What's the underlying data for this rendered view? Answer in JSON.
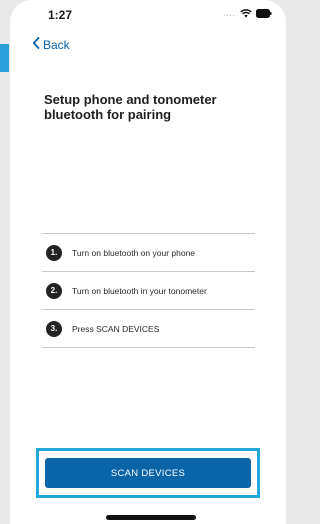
{
  "status_bar": {
    "time": "1:27",
    "signal": "....",
    "wifi_icon": "wifi-icon",
    "battery_icon": "battery-icon"
  },
  "nav": {
    "back_label": "Back",
    "back_icon": "chevron-left-icon"
  },
  "page": {
    "title": "Setup phone and tonometer bluetooth for pairing"
  },
  "steps": [
    {
      "number": "1.",
      "text": "Turn on bluetooth on your phone"
    },
    {
      "number": "2.",
      "text": "Turn on bluetooth in your tonometer"
    },
    {
      "number": "3.",
      "text": "Press SCAN DEVICES"
    }
  ],
  "actions": {
    "scan_label": "SCAN DEVICES"
  },
  "colors": {
    "primary": "#0a64a8",
    "highlight": "#23a8dc",
    "step_badge": "#232323"
  }
}
